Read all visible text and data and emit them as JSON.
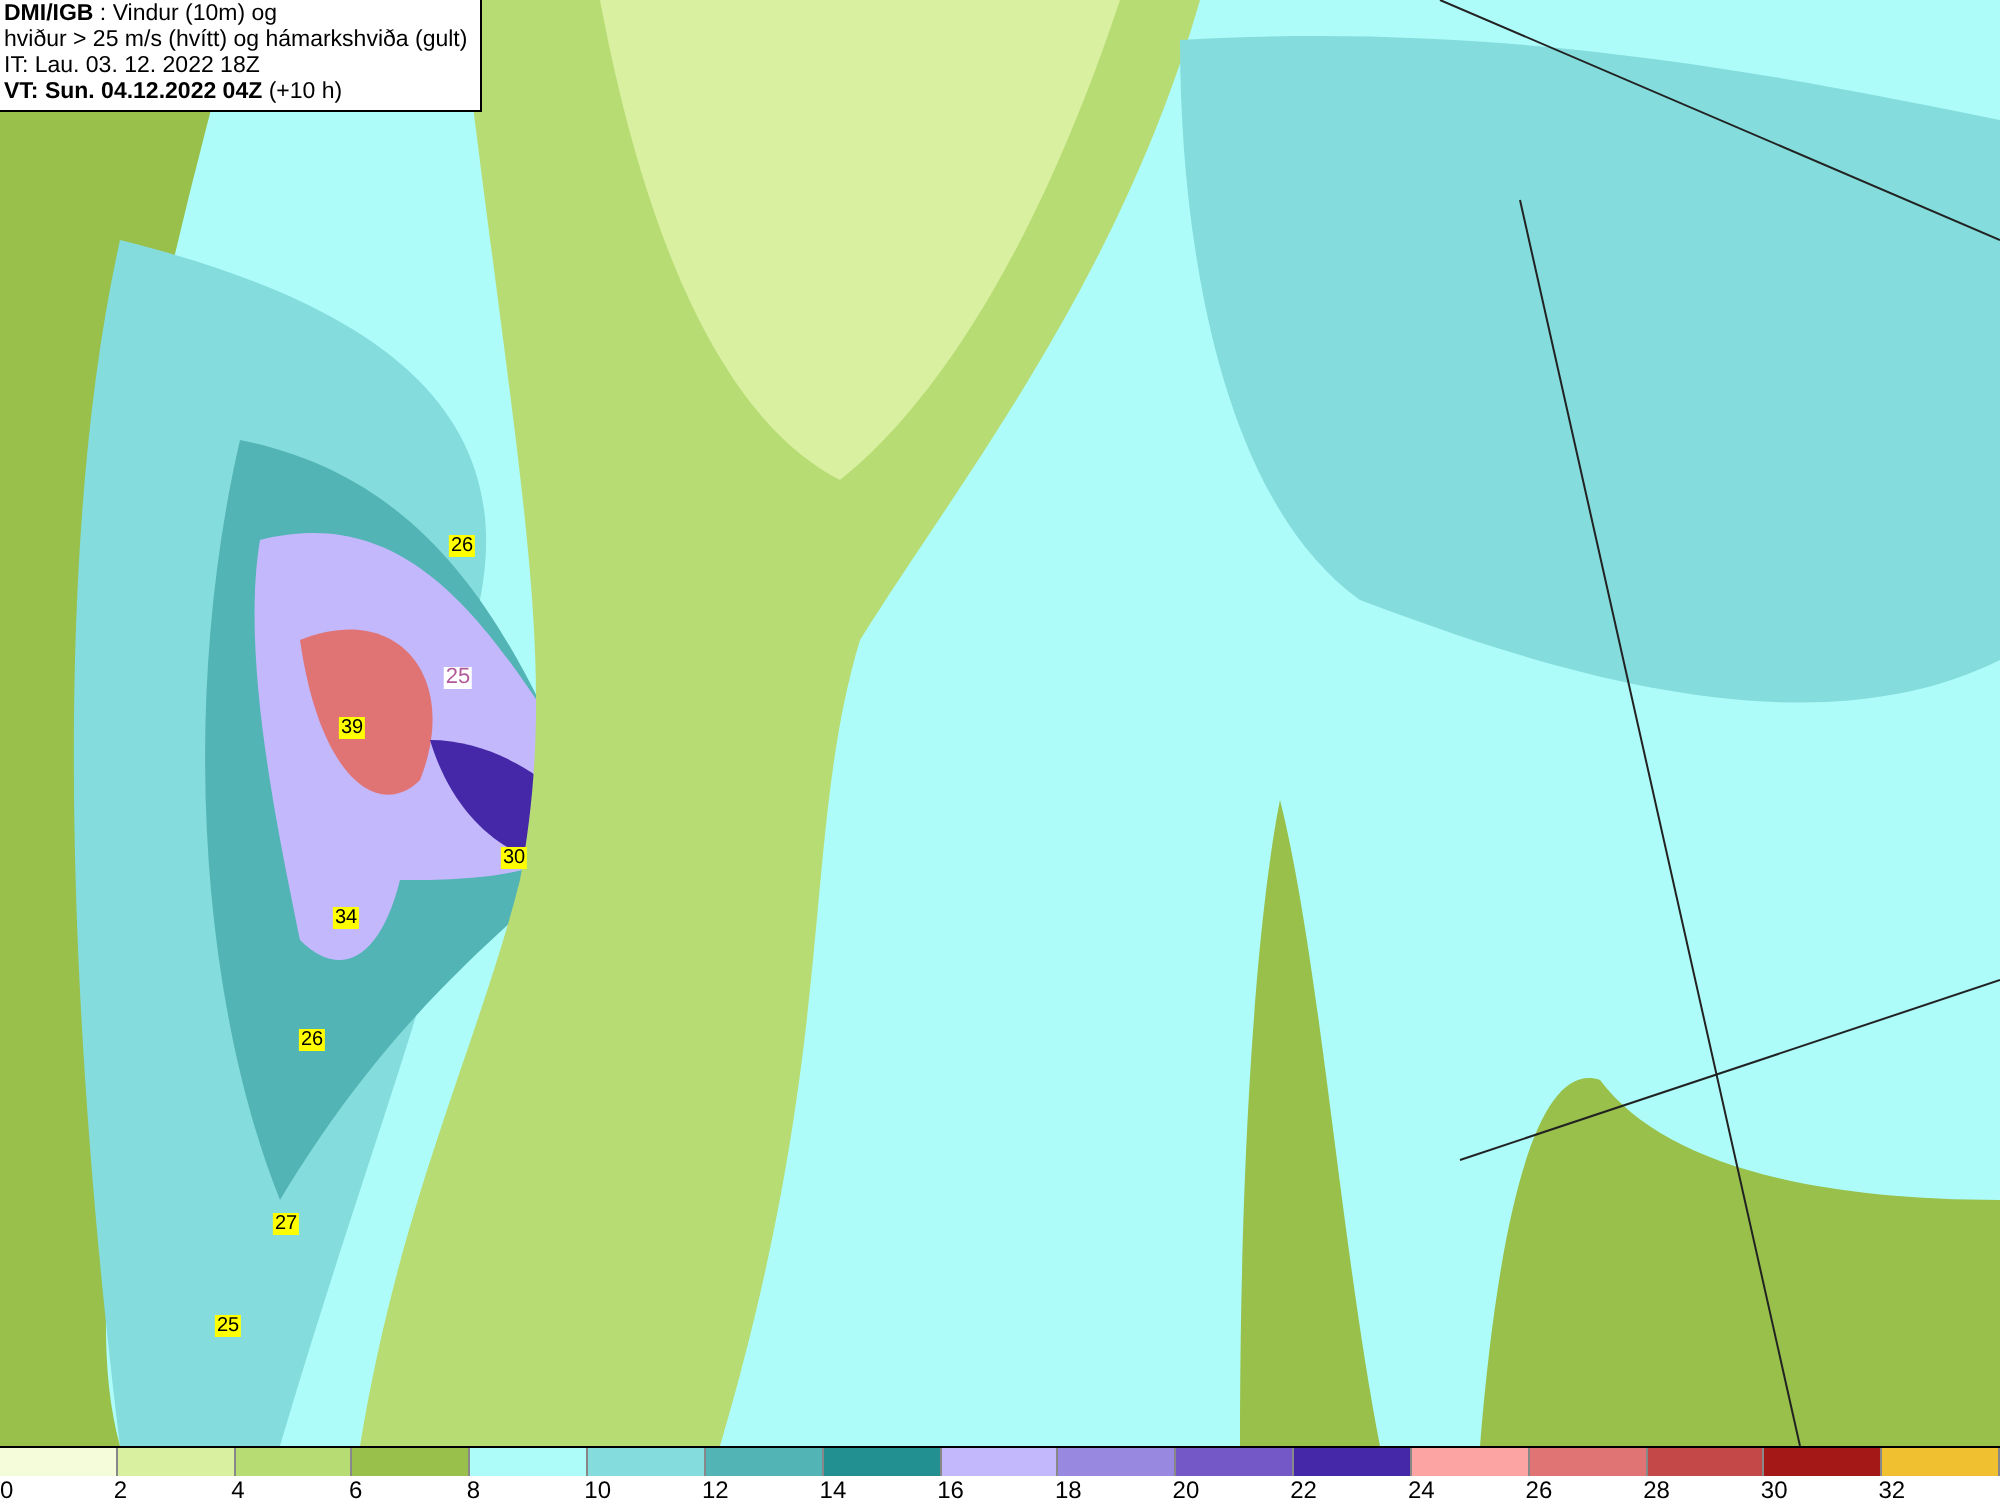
{
  "header": {
    "lines": [
      "**DMI/IGB** : Vindur (10m) og",
      "hviður > 25 m/s (hvítt) og hámarkshviða (gult)",
      "IT: Lau. 03. 12. 2022 18Z",
      "**VT: Sun. 04.12.2022 04Z** (+10 h)"
    ]
  },
  "map": {
    "labels": [
      {
        "text": "26",
        "kind": "gust"
      },
      {
        "text": "25",
        "kind": "contour"
      },
      {
        "text": "39",
        "kind": "gust"
      },
      {
        "text": "30",
        "kind": "gust"
      },
      {
        "text": "34",
        "kind": "gust"
      },
      {
        "text": "26",
        "kind": "gust"
      },
      {
        "text": "27",
        "kind": "gust"
      },
      {
        "text": "25",
        "kind": "gust"
      }
    ]
  },
  "legend": [
    {
      "label": "0",
      "color": "#f5fcd9"
    },
    {
      "label": "2",
      "color": "#d8f0a0"
    },
    {
      "label": "4",
      "color": "#b8dc74"
    },
    {
      "label": "6",
      "color": "#98c04a"
    },
    {
      "label": "8",
      "color": "#aefcfa"
    },
    {
      "label": "10",
      "color": "#84dcdc"
    },
    {
      "label": "12",
      "color": "#52b4b4"
    },
    {
      "label": "14",
      "color": "#229090"
    },
    {
      "label": "16",
      "color": "#c4b8fc"
    },
    {
      "label": "18",
      "color": "#9888e0"
    },
    {
      "label": "20",
      "color": "#7458c8"
    },
    {
      "label": "22",
      "color": "#4428a8"
    },
    {
      "label": "24",
      "color": "#fca4a4"
    },
    {
      "label": "26",
      "color": "#e07474"
    },
    {
      "label": "28",
      "color": "#c44848"
    },
    {
      "label": "30",
      "color": "#a41818"
    },
    {
      "label": "32",
      "color": "#f0c030"
    }
  ]
}
